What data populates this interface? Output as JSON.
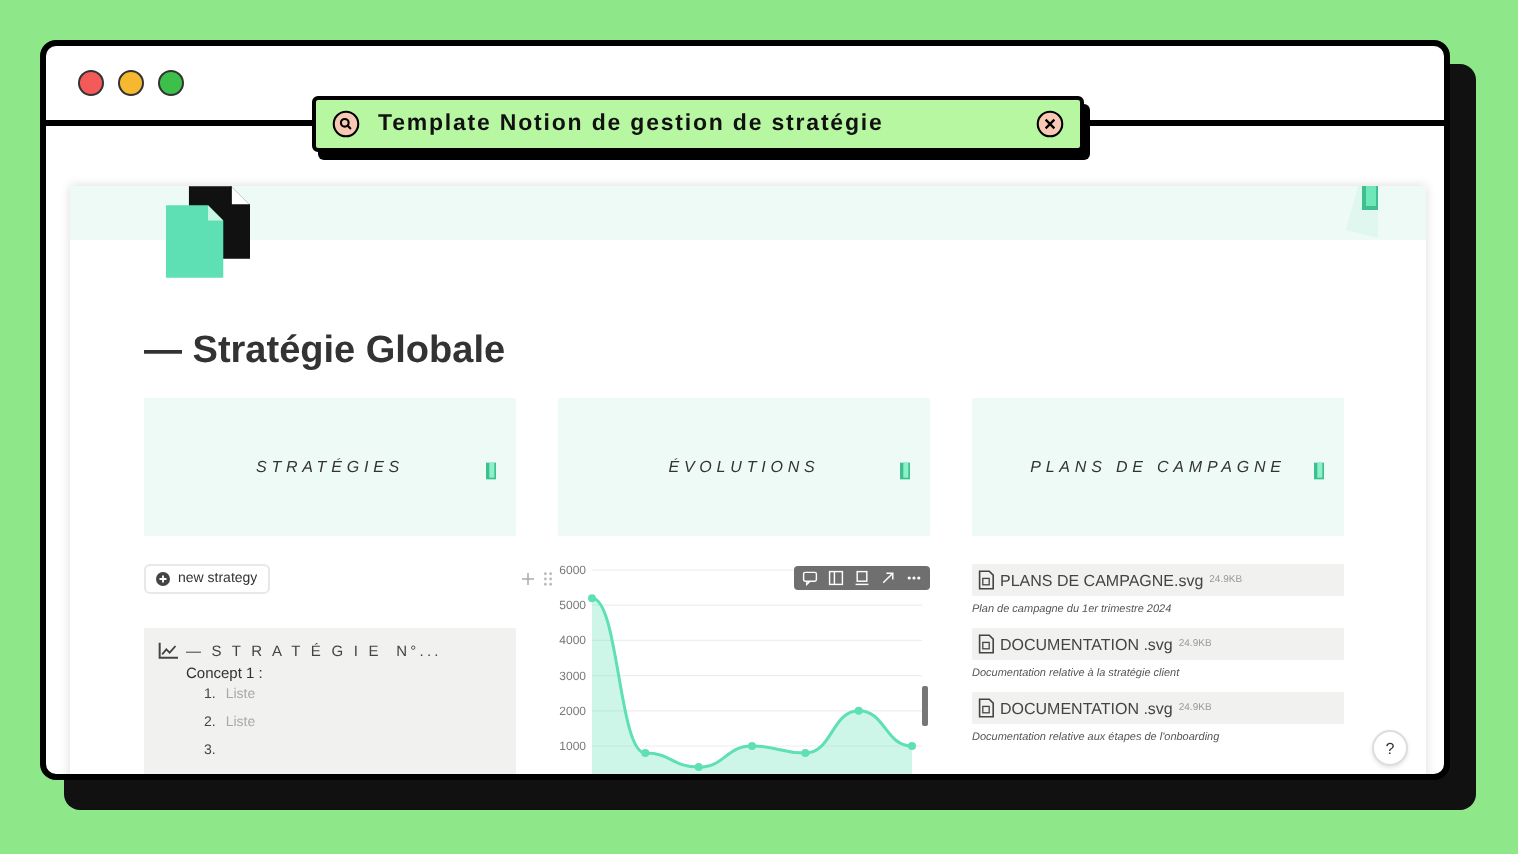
{
  "search_bar": {
    "title": "Template Notion de gestion de stratégie"
  },
  "page": {
    "title": "— Stratégie Globale",
    "cards": [
      {
        "label": "STRATÉGIES"
      },
      {
        "label": "ÉVOLUTIONS"
      },
      {
        "label": "PLANS DE CAMPAGNE"
      }
    ],
    "new_button": {
      "label": "new strategy"
    },
    "gallery_card": {
      "title": "— S T R A T É G I E  N°...",
      "subtitle": "Concept 1 :",
      "list": [
        {
          "number": "1.",
          "text": "Liste"
        },
        {
          "number": "2.",
          "text": "Liste"
        },
        {
          "number": "3."
        }
      ]
    },
    "chart": {
      "chart_data": {
        "type": "area",
        "grid": true,
        "series": [
          {
            "color": "#5ee0b4",
            "values": [
              5200,
              800,
              400,
              1000,
              800,
              2000,
              1000
            ]
          }
        ],
        "ylim": [
          0,
          6000
        ],
        "yticks": [
          1000,
          2000,
          3000,
          4000,
          5000,
          6000
        ]
      }
    },
    "files": [
      {
        "name": "PLANS DE CAMPAGNE.svg",
        "size": "24.9KB",
        "caption": "Plan de campagne du 1er trimestre 2024"
      },
      {
        "name": "DOCUMENTATION .svg",
        "size": "24.9KB",
        "caption": "Documentation relative à la stratégie client"
      },
      {
        "name": "DOCUMENTATION .svg",
        "size": "24.9KB",
        "caption": "Documentation relative aux étapes de l'onboarding"
      }
    ],
    "help_button": {
      "label": "?"
    }
  }
}
